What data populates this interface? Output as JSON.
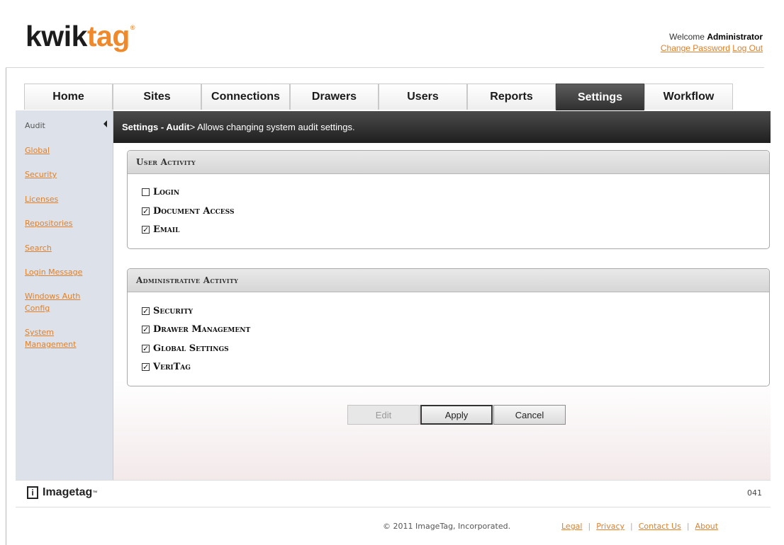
{
  "header": {
    "logo_kwik": "kwik",
    "logo_tag": "tag",
    "logo_mark": "®",
    "welcome_prefix": "Welcome",
    "user": "Administrator",
    "change_password": "Change Password",
    "logout": "Log Out"
  },
  "tabs": [
    {
      "label": "Home"
    },
    {
      "label": "Sites"
    },
    {
      "label": "Connections"
    },
    {
      "label": "Drawers"
    },
    {
      "label": "Users"
    },
    {
      "label": "Reports"
    },
    {
      "label": "Settings",
      "active": true
    },
    {
      "label": "Workflow"
    }
  ],
  "sidebar": {
    "current": "Audit",
    "items": [
      {
        "label": "Global"
      },
      {
        "label": "Security"
      },
      {
        "label": "Licenses"
      },
      {
        "label": "Repositories"
      },
      {
        "label": "Search"
      },
      {
        "label": "Login Message"
      },
      {
        "label": "Windows Auth Config"
      },
      {
        "label": "System Management"
      }
    ]
  },
  "titlebar": {
    "section": "Settings - Audit",
    "description": " > Allows changing system audit settings."
  },
  "user_activity": {
    "title": "User Activity",
    "items": [
      {
        "label": "Login",
        "checked": false
      },
      {
        "label": "Document Access",
        "checked": true
      },
      {
        "label": "Email",
        "checked": true
      }
    ]
  },
  "admin_activity": {
    "title": "Administrative Activity",
    "items": [
      {
        "label": "Security",
        "checked": true
      },
      {
        "label": "Drawer Management",
        "checked": true
      },
      {
        "label": "Global Settings",
        "checked": true
      },
      {
        "label": "VeriTag",
        "checked": true
      }
    ]
  },
  "buttons": {
    "edit": "Edit",
    "apply": "Apply",
    "cancel": "Cancel"
  },
  "footer": {
    "brand": "Imagetag",
    "brand_mark": "™",
    "brand_icon": "i",
    "page_code": "041",
    "copyright": "© 2011 ImageTag, Incorporated.",
    "links": {
      "legal": "Legal",
      "privacy": "Privacy",
      "contact": "Contact Us",
      "about": "About"
    },
    "separator": "|"
  },
  "colors": {
    "accent": "#e0802a",
    "active_tab": "#3a3a3a",
    "sidebar": "#dde2ea"
  },
  "icons": {
    "collapse": "triangle-left-icon",
    "check": "checkbox-icon"
  }
}
